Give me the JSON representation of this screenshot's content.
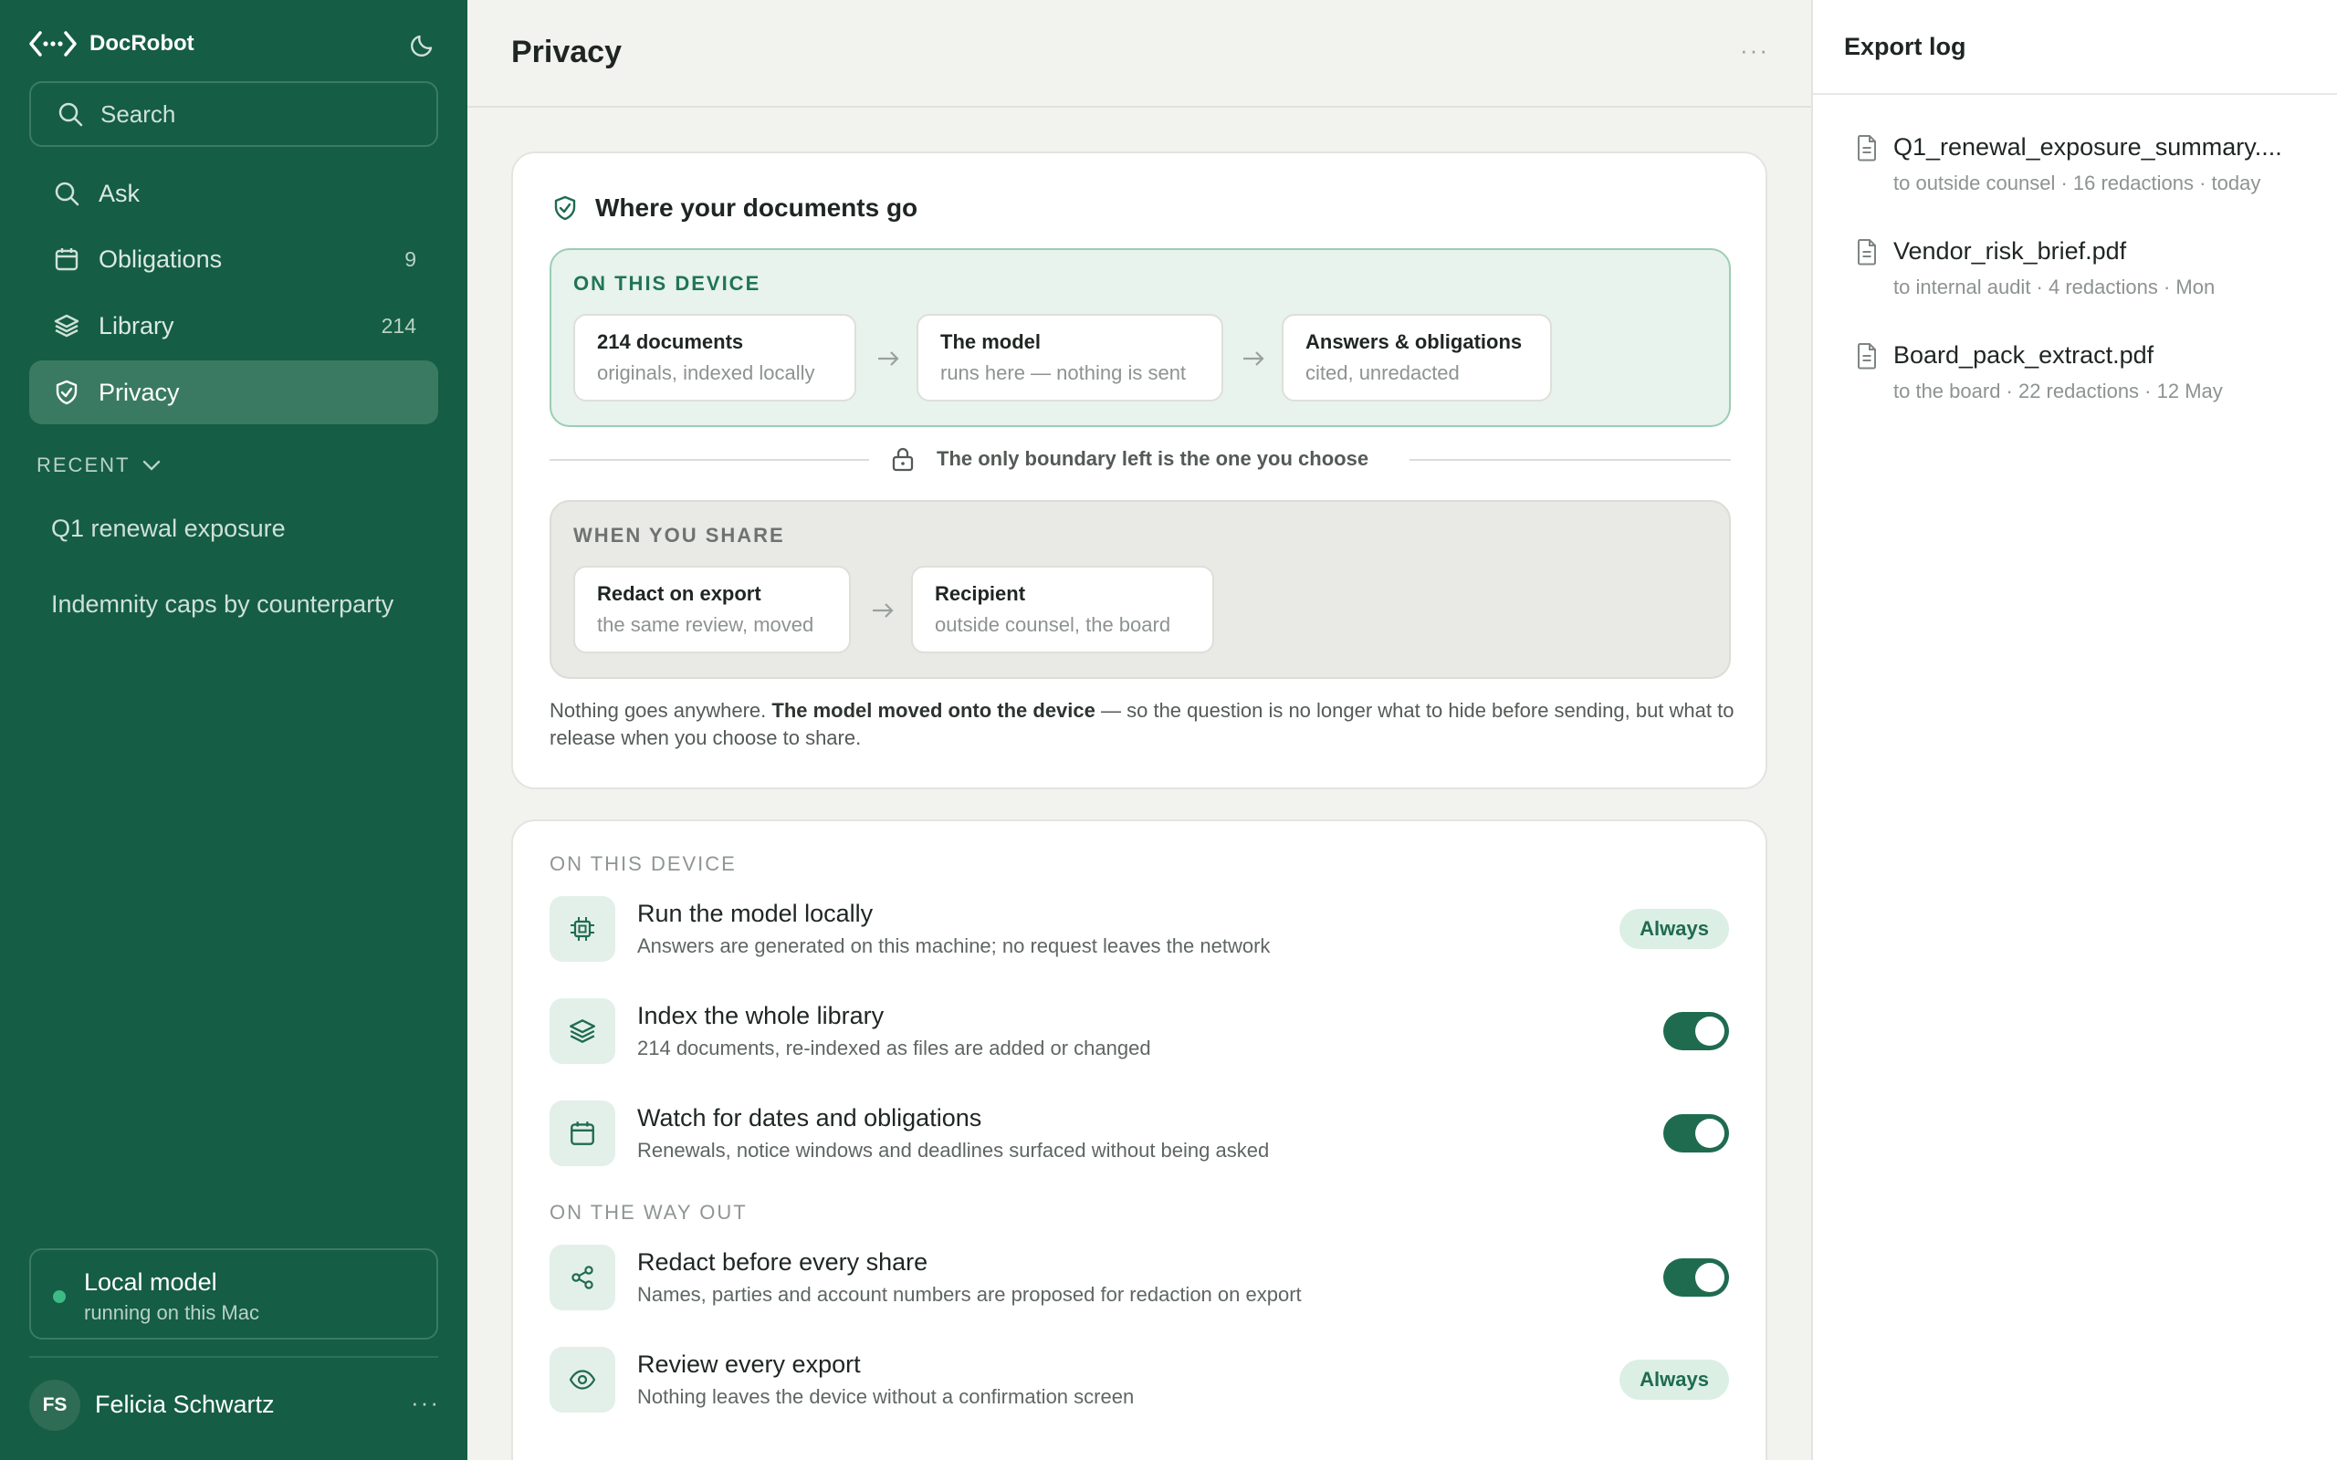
{
  "sidebar": {
    "brand": "DocRobot",
    "search_placeholder": "Search",
    "nav": [
      {
        "label": "Ask",
        "icon": "search-icon",
        "count": ""
      },
      {
        "label": "Obligations",
        "icon": "calendar-icon",
        "count": "9"
      },
      {
        "label": "Library",
        "icon": "layers-icon",
        "count": "214"
      },
      {
        "label": "Privacy",
        "icon": "shield-icon",
        "count": "",
        "active": true
      }
    ],
    "recent_label": "RECENT",
    "recent": [
      "Q1 renewal exposure",
      "Indemnity caps by counterparty"
    ],
    "model": {
      "title": "Local model",
      "subtitle": "running on this Mac"
    },
    "user": {
      "initials": "FS",
      "name": "Felicia Schwartz"
    }
  },
  "main": {
    "title": "Privacy",
    "flow_card": {
      "heading": "Where your documents go",
      "device_label": "ON THIS DEVICE",
      "device_steps": [
        {
          "title": "214 documents",
          "subtitle": "originals, indexed locally"
        },
        {
          "title": "The model",
          "subtitle": "runs here — nothing is sent"
        },
        {
          "title": "Answers & obligations",
          "subtitle": "cited, unredacted"
        }
      ],
      "boundary_text": "The only boundary left is the one you choose",
      "share_label": "WHEN YOU SHARE",
      "share_steps": [
        {
          "title": "Redact on export",
          "subtitle": "the same review, moved"
        },
        {
          "title": "Recipient",
          "subtitle": "outside counsel, the board"
        }
      ],
      "explain_prefix": "Nothing goes anywhere. ",
      "explain_bold": "The model moved onto the device",
      "explain_suffix": " — so the question is no longer what to hide before sending, but what to release when you choose to share."
    },
    "settings": {
      "device_label": "ON THIS DEVICE",
      "way_out_label": "ON THE WAY OUT",
      "items": [
        {
          "title": "Run the model locally",
          "subtitle": "Answers are generated on this machine; no request leaves the network",
          "icon": "chip-icon",
          "control": "badge",
          "badge": "Always"
        },
        {
          "title": "Index the whole library",
          "subtitle": "214 documents, re-indexed as files are added or changed",
          "icon": "layers-icon",
          "control": "toggle",
          "on": true
        },
        {
          "title": "Watch for dates and obligations",
          "subtitle": "Renewals, notice windows and deadlines surfaced without being asked",
          "icon": "calendar-icon",
          "control": "toggle",
          "on": true
        },
        {
          "title": "Redact before every share",
          "subtitle": "Names, parties and account numbers are proposed for redaction on export",
          "icon": "share-icon",
          "control": "toggle",
          "on": true
        },
        {
          "title": "Review every export",
          "subtitle": "Nothing leaves the device without a confirmation screen",
          "icon": "eye-icon",
          "control": "badge",
          "badge": "Always"
        }
      ]
    }
  },
  "export_log": {
    "title": "Export log",
    "items": [
      {
        "name": "Q1_renewal_exposure_summary....",
        "meta": "to outside counsel · 16 redactions · today"
      },
      {
        "name": "Vendor_risk_brief.pdf",
        "meta": "to internal audit · 4 redactions · Mon"
      },
      {
        "name": "Board_pack_extract.pdf",
        "meta": "to the board · 22 redactions · 12 May"
      }
    ]
  },
  "colors": {
    "sidebar": "#155d45",
    "accent": "#1f6b50",
    "device_zone": "#e7f3ec",
    "share_zone": "#e9e9e6"
  }
}
